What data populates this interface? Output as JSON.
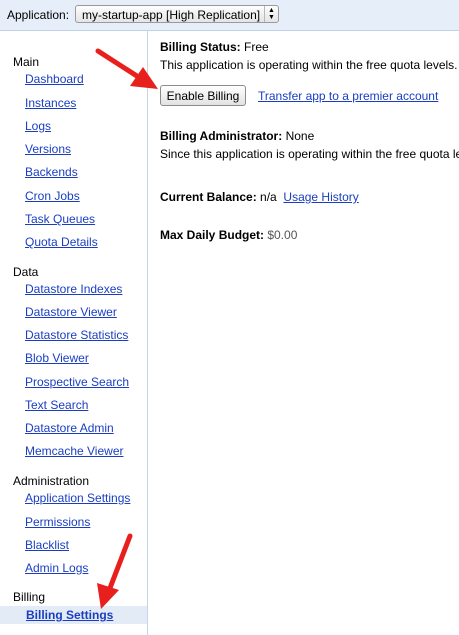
{
  "appbar": {
    "label": "Application:",
    "app_selected": "my-startup-app [High Replication]",
    "select_arrows": "▲▼"
  },
  "sidebar": {
    "sections": [
      {
        "title": "Main",
        "items": [
          "Dashboard",
          "Instances",
          "Logs",
          "Versions",
          "Backends",
          "Cron Jobs",
          "Task Queues",
          "Quota Details"
        ]
      },
      {
        "title": "Data",
        "items": [
          "Datastore Indexes",
          "Datastore Viewer",
          "Datastore Statistics",
          "Blob Viewer",
          "Prospective Search",
          "Text Search",
          "Datastore Admin",
          "Memcache Viewer"
        ]
      },
      {
        "title": "Administration",
        "items": [
          "Application Settings",
          "Permissions",
          "Blacklist",
          "Admin Logs"
        ]
      },
      {
        "title": "Billing",
        "items": [
          "Billing Settings"
        ]
      }
    ],
    "selected_item": "Billing Settings"
  },
  "main": {
    "billing_status_label": "Billing Status:",
    "billing_status_value": "Free",
    "status_description": "This application is operating within the free quota levels.",
    "enable_billing_button": "Enable Billing",
    "transfer_link": "Transfer app to a premier account",
    "billing_admin_label": "Billing Administrator:",
    "billing_admin_value": "None",
    "admin_description": "Since this application is operating within the free quota le",
    "current_balance_label": "Current Balance:",
    "current_balance_value": "n/a",
    "usage_history_link": "Usage History",
    "max_budget_label": "Max Daily Budget:",
    "max_budget_value": "$0.00"
  },
  "colors": {
    "link": "#1a3ec1",
    "annotation_arrow": "#e8201d",
    "selected_bg": "#e3ebf6"
  }
}
